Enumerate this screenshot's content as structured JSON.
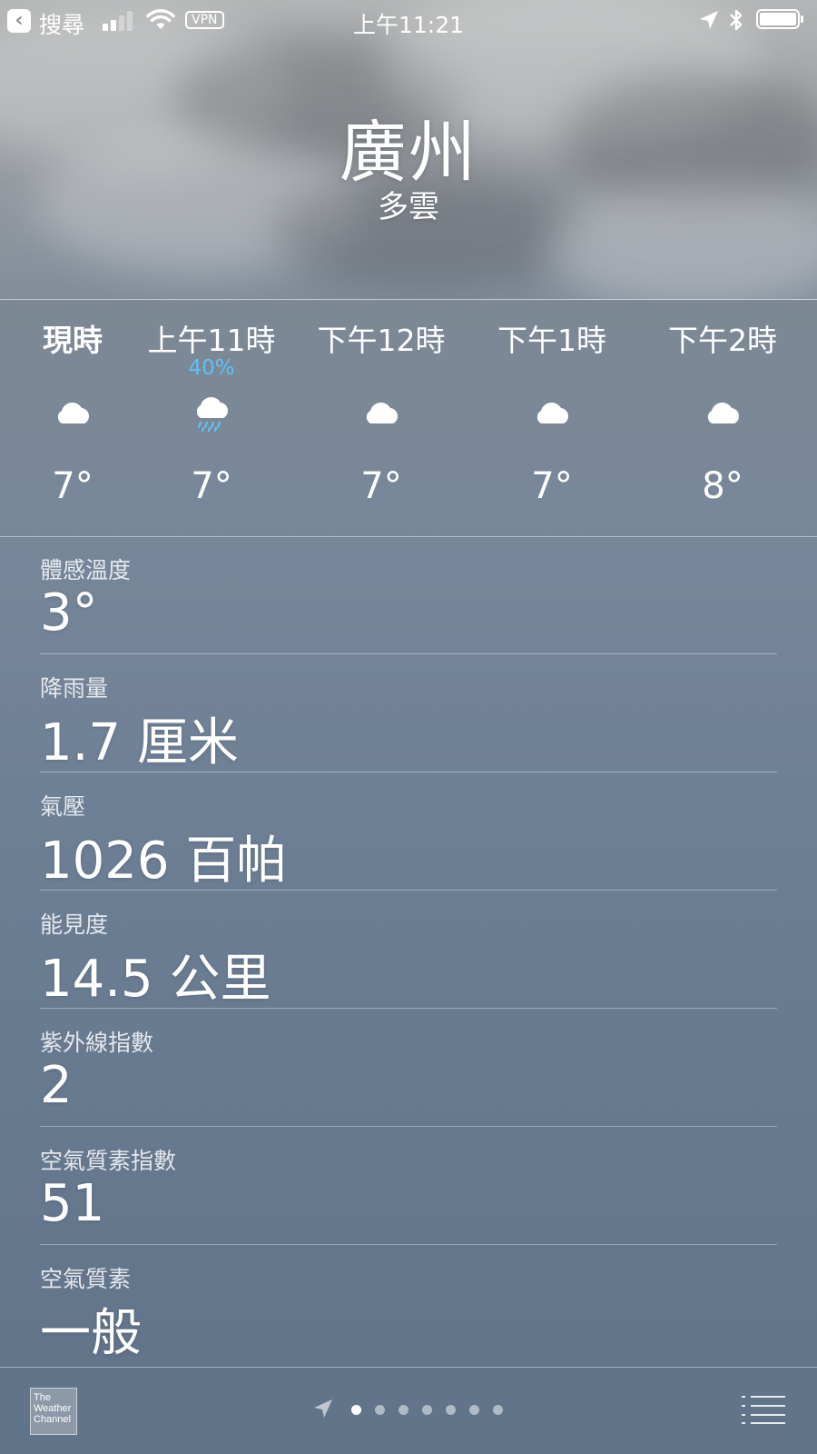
{
  "status_bar": {
    "back_label": "搜尋",
    "vpn": "VPN",
    "time": "上午11:21"
  },
  "header": {
    "city": "廣州",
    "condition": "多雲"
  },
  "hourly": [
    {
      "time": "現時",
      "pop": "",
      "icon": "cloud-icon",
      "temp": "7°"
    },
    {
      "time": "上午11時",
      "pop": "40%",
      "icon": "cloud-rain-icon",
      "temp": "7°"
    },
    {
      "time": "下午12時",
      "pop": "",
      "icon": "cloud-icon",
      "temp": "7°"
    },
    {
      "time": "下午1時",
      "pop": "",
      "icon": "cloud-icon",
      "temp": "7°"
    },
    {
      "time": "下午2時",
      "pop": "",
      "icon": "cloud-icon",
      "temp": "8°"
    }
  ],
  "details": [
    {
      "label": "體感溫度",
      "value": "3°"
    },
    {
      "label": "降雨量",
      "value": "1.7 厘米"
    },
    {
      "label": "氣壓",
      "value": "1026 百帕"
    },
    {
      "label": "能見度",
      "value": "14.5 公里"
    },
    {
      "label": "紫外線指數",
      "value": "2"
    },
    {
      "label": "空氣質素指數",
      "value": "51"
    },
    {
      "label": "空氣質素",
      "value": "一般"
    }
  ],
  "toolbar": {
    "logo_lines": [
      "The",
      "Weather",
      "Channel"
    ],
    "page_count": 7,
    "active_page": 1
  },
  "colors": {
    "precip_blue": "#5ec2f7"
  }
}
